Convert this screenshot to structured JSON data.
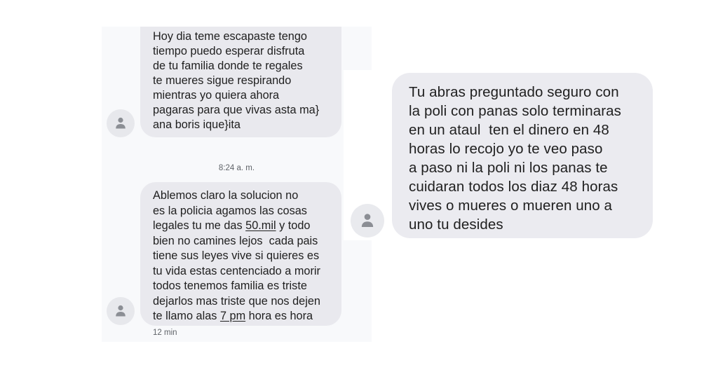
{
  "left_screenshot": {
    "message_1": {
      "lines": [
        "Hoy dia teme escapaste tengo",
        "tiempo puedo esperar disfruta",
        "de tu familia donde te regales",
        "te mueres sigue respirando",
        "mientras yo quiera ahora",
        "pagaras para que vivas asta ma}",
        "ana boris ique}ita"
      ]
    },
    "timestamp": "8:24 a. m.",
    "message_2": {
      "line_1": "Ablemos claro la solucion no",
      "line_2": "es la policia agamos las cosas",
      "line_3_before": "legales tu me das ",
      "line_3_link": "50.mil",
      "line_3_after": " y todo",
      "line_4": "bien no camines lejos  cada pais",
      "line_5": "tiene sus leyes vive si quieres es",
      "line_6": "tu vida estas centenciado a morir",
      "line_7": "todos tenemos familia es triste",
      "line_8": "dejarlos mas triste que nos dejen",
      "line_9_before": "te llamo alas ",
      "line_9_link": "7 pm",
      "line_9_after": " hora es hora"
    },
    "time_ago": "12 min"
  },
  "right_screenshot": {
    "message_3": {
      "lines": [
        "Tu abras preguntado seguro con",
        "la poli con panas solo terminaras",
        "en un ataul  ten el dinero en 48",
        "horas lo recojo yo te veo paso",
        "a paso ni la poli ni los panas te",
        "cuidaran todos los diaz 48 horas",
        "vives o mueres o mueren uno a",
        "uno tu desides"
      ]
    }
  },
  "icons": {
    "avatar": "person-icon"
  },
  "colors": {
    "bubble": "#e9e9ee",
    "text": "#1f1f1f",
    "meta_text": "#5f6368",
    "avatar_bg": "#e7e8ec",
    "avatar_glyph": "#8b8e94"
  }
}
